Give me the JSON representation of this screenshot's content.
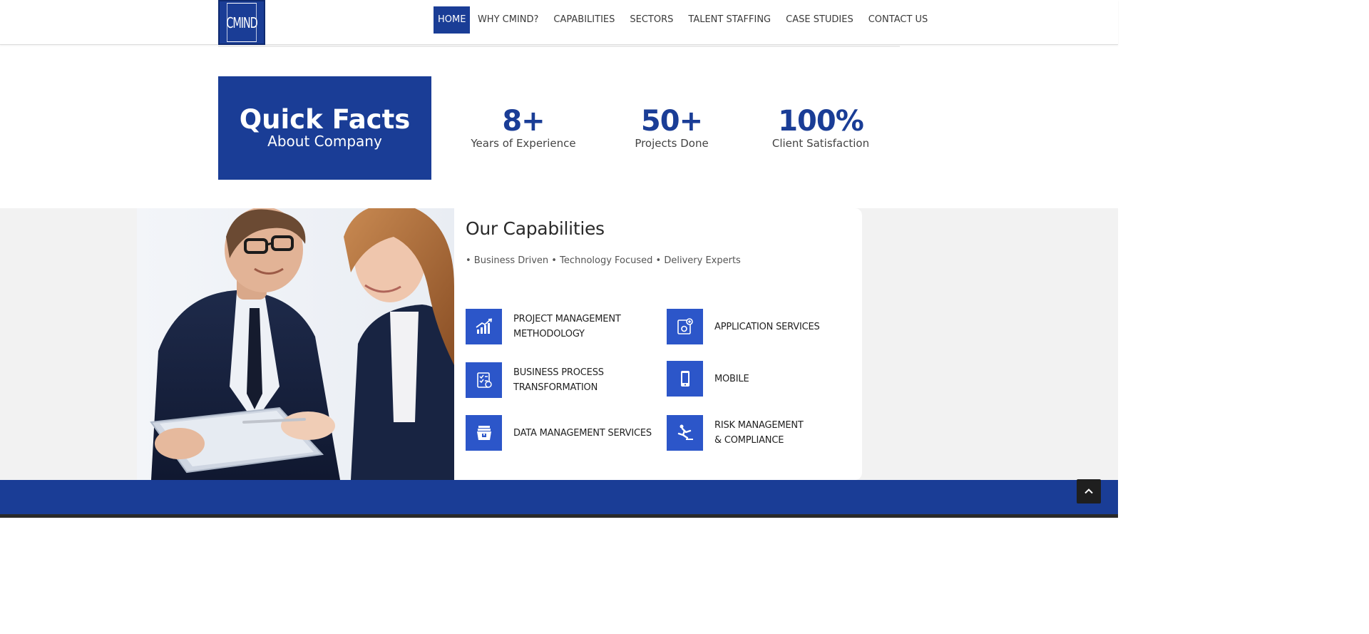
{
  "header": {
    "logo_text": "CMIND",
    "nav": [
      {
        "label": "HOME",
        "active": true
      },
      {
        "label": "WHY CMIND?",
        "active": false
      },
      {
        "label": "CAPABILITIES",
        "active": false
      },
      {
        "label": "SECTORS",
        "active": false
      },
      {
        "label": "TALENT STAFFING",
        "active": false
      },
      {
        "label": "CASE STUDIES",
        "active": false
      },
      {
        "label": "CONTACT US",
        "active": false
      }
    ]
  },
  "quick_facts": {
    "title": "Quick Facts",
    "subtitle": "About Company",
    "stats": [
      {
        "value": "8+",
        "label": "Years of Experience"
      },
      {
        "value": "50+",
        "label": "Projects Done"
      },
      {
        "value": "100%",
        "label": "Client Satisfaction"
      }
    ]
  },
  "capabilities": {
    "title": "Our Capabilities",
    "tagline": "• Business Driven • Technology Focused • Delivery Experts",
    "items": [
      {
        "label_line1": "PROJECT MANAGEMENT",
        "label_line2": "METHODOLOGY",
        "icon": "growth-chart-icon"
      },
      {
        "label_line1": "APPLICATION SERVICES",
        "label_line2": "",
        "icon": "app-settings-icon"
      },
      {
        "label_line1": "BUSINESS PROCESS",
        "label_line2": "TRANSFORMATION",
        "icon": "checklist-icon"
      },
      {
        "label_line1": "MOBILE",
        "label_line2": "",
        "icon": "mobile-phone-icon"
      },
      {
        "label_line1": "DATA MANAGEMENT SERVICES",
        "label_line2": "",
        "icon": "data-archive-icon"
      },
      {
        "label_line1": "RISK MANAGEMENT",
        "label_line2": "& COMPLIANCE",
        "icon": "slip-hazard-icon"
      }
    ]
  },
  "colors": {
    "brand_blue": "#1a3d96",
    "icon_blue": "#2c56c9",
    "section_gray": "#f2f2f2"
  }
}
